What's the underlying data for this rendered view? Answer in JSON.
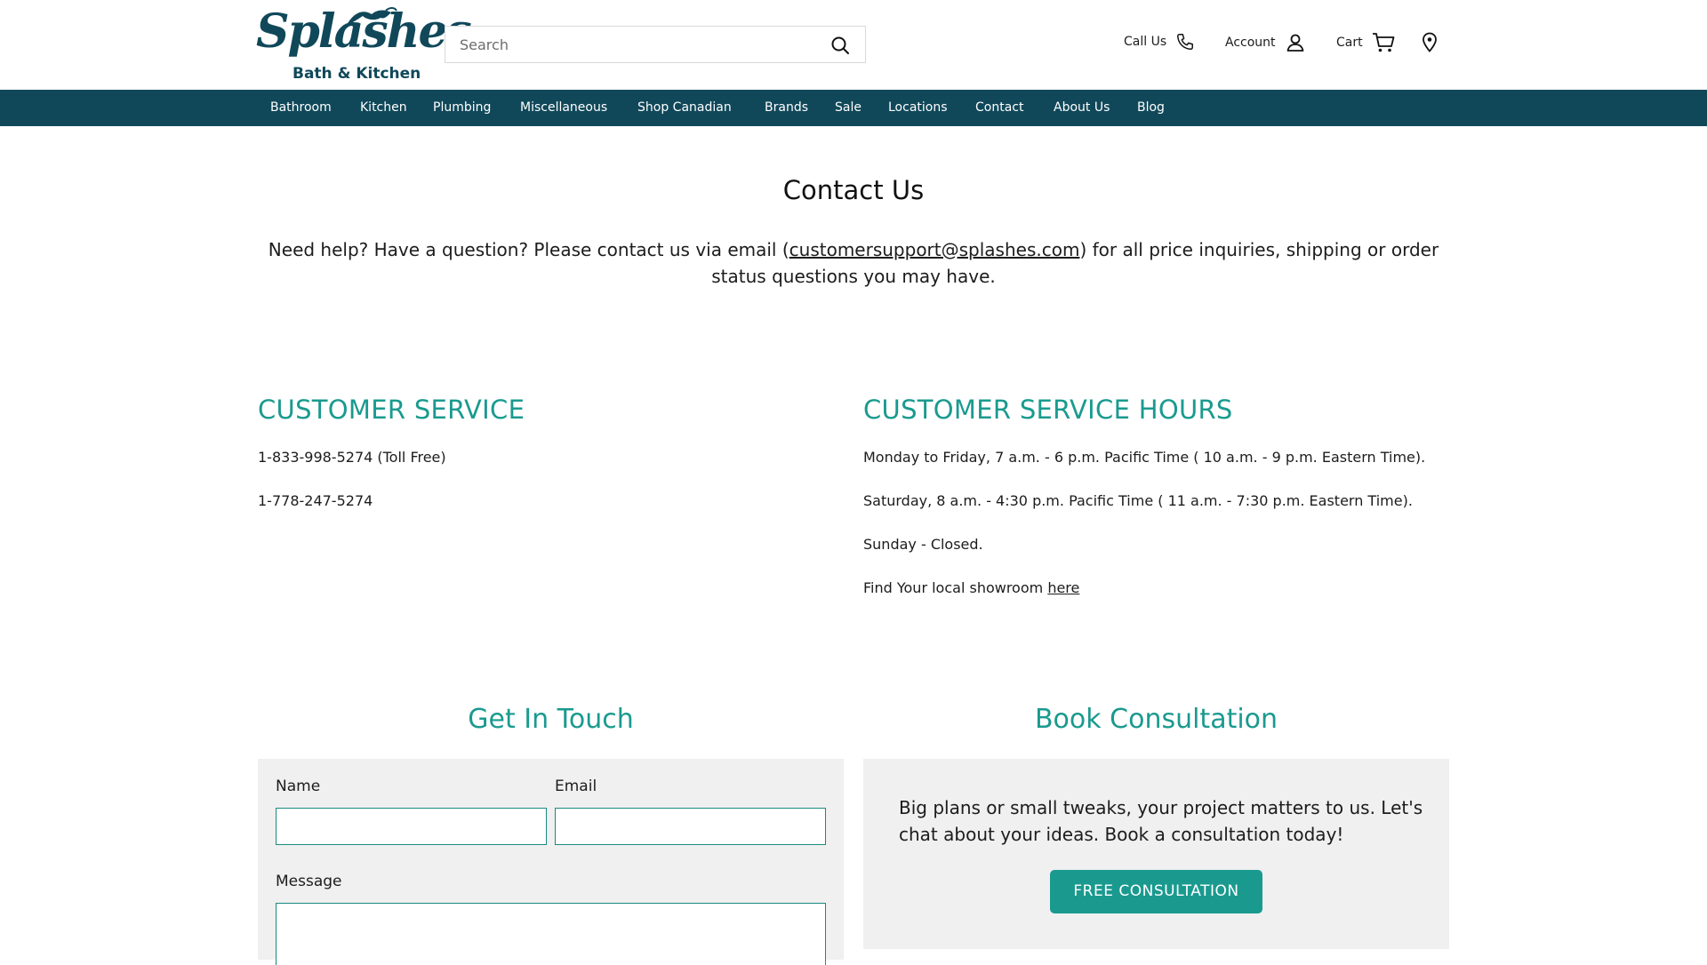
{
  "header": {
    "logo": {
      "word": "Splashes",
      "subtitle": "Bath & Kitchen",
      "color": "#10485a"
    },
    "search": {
      "placeholder": "Search",
      "value": "",
      "icon": "search-icon"
    },
    "utilities": [
      {
        "label": "Call Us",
        "icon": "phone-icon"
      },
      {
        "label": "Account",
        "icon": "user-icon"
      },
      {
        "label": "Cart",
        "icon": "cart-icon"
      },
      {
        "label": "",
        "icon": "location-pin-icon"
      }
    ]
  },
  "nav": {
    "background": "#10485a",
    "items": [
      "Bathroom",
      "Kitchen",
      "Plumbing",
      "Miscellaneous",
      "Shop Canadian",
      "Brands",
      "Sale",
      "Locations",
      "Contact",
      "About Us",
      "Blog"
    ]
  },
  "main": {
    "title": "Contact Us",
    "intro_before": "Need help? Have a question? Please contact us via email (",
    "intro_email": "customersupport@splashes.com",
    "intro_after": ") for all price inquiries, shipping or order status questions you may have."
  },
  "customer_service": {
    "heading": "CUSTOMER SERVICE",
    "phones": [
      "1-833-998-5274 (Toll Free)",
      "1-778-247-5274"
    ]
  },
  "hours": {
    "heading": "CUSTOMER SERVICE HOURS",
    "lines": [
      "Monday to Friday, 7 a.m. - 6 p.m. Pacific Time ( 10 a.m. - 9 p.m. Eastern Time).",
      "Saturday, 8 a.m. - 4:30 p.m. Pacific Time ( 11 a.m. - 7:30 p.m. Eastern Time).",
      "Sunday - Closed."
    ],
    "showroom_text": "Find Your local showroom ",
    "showroom_link": "here"
  },
  "get_in_touch": {
    "heading": "Get In Touch",
    "name_label": "Name",
    "name_value": "",
    "email_label": "Email",
    "email_value": "",
    "message_label": "Message",
    "message_value": ""
  },
  "consultation": {
    "heading": "Book Consultation",
    "text": "Big plans or small tweaks, your project matters to us. Let's chat about your ideas. Book a consultation today!",
    "button": "FREE CONSULTATION"
  },
  "colors": {
    "accent": "#1a9a8f",
    "nav": "#10485a",
    "panel": "#f0f0f0"
  }
}
